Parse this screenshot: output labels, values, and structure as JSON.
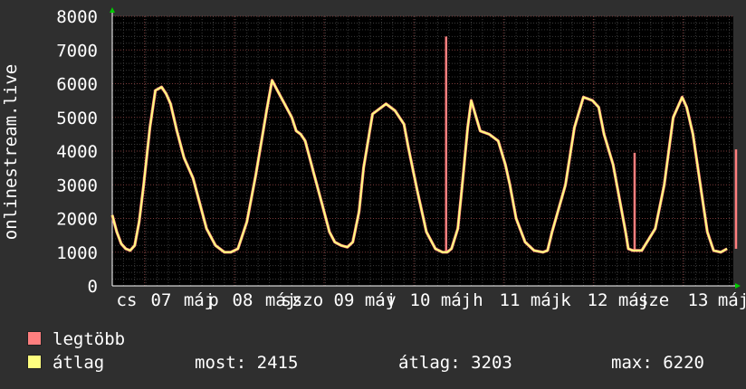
{
  "chart_data": {
    "type": "line",
    "ylabel": "onlinestream.live",
    "ylim": [
      0,
      8000
    ],
    "yticks": [
      0,
      1000,
      2000,
      3000,
      4000,
      5000,
      6000,
      7000,
      8000
    ],
    "xtick_labels": [
      "cs",
      "07",
      "máj",
      "p",
      "08",
      "máj",
      "sz",
      "szo",
      "09",
      "máj",
      "v",
      "10",
      "máj",
      "h",
      "11",
      "máj",
      "k",
      "12",
      "máj",
      "sze",
      "13",
      "máj"
    ],
    "grid": true,
    "background": "#000000",
    "series": [
      {
        "name": "legtöbb",
        "color": "#ff7f7f",
        "note": "maximum series; mostly coincides with átlag except spikes",
        "spikes": [
          {
            "x": 3.72,
            "value": 7400
          },
          {
            "x": 5.82,
            "value": 3950
          },
          {
            "x": 6.95,
            "value": 4050
          }
        ]
      },
      {
        "name": "átlag",
        "color": "#ffff7f",
        "x_unit": "days from start of plot",
        "x": [
          0,
          0.05,
          0.1,
          0.15,
          0.2,
          0.25,
          0.3,
          0.35,
          0.42,
          0.48,
          0.55,
          0.6,
          0.65,
          0.72,
          0.8,
          0.9,
          1.05,
          1.15,
          1.25,
          1.32,
          1.4,
          1.5,
          1.6,
          1.72,
          1.78,
          1.82,
          2.0,
          2.05,
          2.1,
          2.15,
          2.25,
          2.35,
          2.42,
          2.48,
          2.55,
          2.62,
          2.68,
          2.75,
          2.8,
          2.9,
          3.05,
          3.15,
          3.25,
          3.3,
          3.4,
          3.5,
          3.6,
          3.68,
          3.73,
          3.78,
          3.85,
          3.9,
          3.96,
          4.0,
          4.1,
          4.2,
          4.3,
          4.38,
          4.43,
          4.5,
          4.6,
          4.7,
          4.8,
          4.85,
          4.9,
          5.05,
          5.15,
          5.25,
          5.35,
          5.42,
          5.48,
          5.58,
          5.65,
          5.72,
          5.75,
          5.8,
          5.9,
          6.05,
          6.15,
          6.25,
          6.35,
          6.4,
          6.47,
          6.52,
          6.58,
          6.63,
          6.7,
          6.78,
          6.85
        ],
        "values": [
          2100,
          1600,
          1250,
          1100,
          1050,
          1200,
          1900,
          3000,
          4700,
          5800,
          5900,
          5700,
          5400,
          4600,
          3800,
          3200,
          1700,
          1200,
          1000,
          1000,
          1100,
          1900,
          3300,
          5200,
          6100,
          5900,
          5000,
          4600,
          4500,
          4300,
          3300,
          2300,
          1600,
          1300,
          1200,
          1150,
          1300,
          2200,
          3500,
          5100,
          5400,
          5200,
          4800,
          4100,
          2800,
          1600,
          1100,
          1000,
          1000,
          1100,
          1700,
          3000,
          4700,
          5500,
          4600,
          4500,
          4300,
          3600,
          3000,
          2000,
          1300,
          1050,
          1000,
          1050,
          1600,
          3000,
          4700,
          5600,
          5500,
          5300,
          4500,
          3600,
          2600,
          1600,
          1100,
          1050,
          1050,
          1700,
          3000,
          5000,
          5600,
          5300,
          4500,
          3600,
          2500,
          1600,
          1050,
          1000,
          1100
        ]
      }
    ]
  },
  "legend": {
    "max_label": "legtöbb",
    "avg_label": "átlag"
  },
  "stats": {
    "most": "most: 2415",
    "atlag": "átlag: 3203",
    "max": "max: 6220"
  }
}
